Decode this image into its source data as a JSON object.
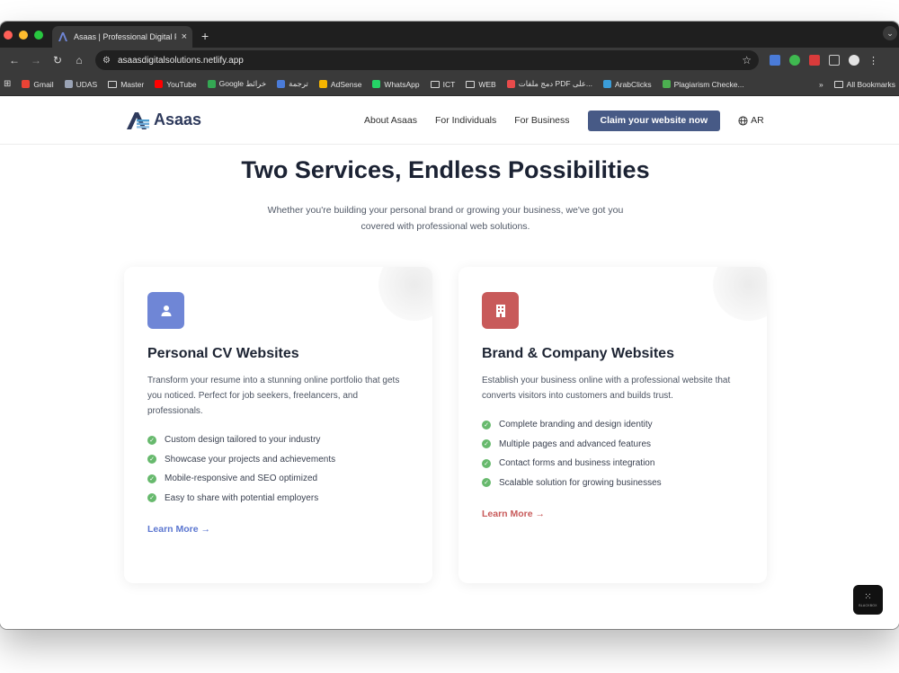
{
  "browser": {
    "tab_title": "Asaas | Professional Digital Pr",
    "url": "asaasdigitalsolutions.netlify.app",
    "new_tab": "+",
    "bookmarks": [
      {
        "label": "Gmail",
        "kind": "gmail",
        "color": "#ea4335"
      },
      {
        "label": "UDAS",
        "kind": "site",
        "color": "#9aa3b5"
      },
      {
        "label": "Master",
        "kind": "folder"
      },
      {
        "label": "YouTube",
        "kind": "site",
        "color": "#ff0000"
      },
      {
        "label": "Google خرائط",
        "kind": "site",
        "color": "#34a853"
      },
      {
        "label": "ترجمة",
        "kind": "site",
        "color": "#4a7bd8"
      },
      {
        "label": "AdSense",
        "kind": "site",
        "color": "#f4b400"
      },
      {
        "label": "WhatsApp",
        "kind": "site",
        "color": "#25d366"
      },
      {
        "label": "ICT",
        "kind": "folder"
      },
      {
        "label": "WEB",
        "kind": "folder"
      },
      {
        "label": "دمج ملفات PDF على...",
        "kind": "site",
        "color": "#e84b4b"
      },
      {
        "label": "ArabClicks",
        "kind": "site",
        "color": "#3b9dd8"
      },
      {
        "label": "Plagiarism Checke...",
        "kind": "site",
        "color": "#4caf50"
      }
    ],
    "overflow": "»",
    "all_bookmarks": "All Bookmarks"
  },
  "site": {
    "logo_text": "Asaas",
    "nav": {
      "about": "About Asaas",
      "individuals": "For Individuals",
      "business": "For Business",
      "cta": "Claim your website now",
      "lang": "AR"
    },
    "hero": {
      "title": "Two Services, Endless Possibilities",
      "subtitle_line1": "Whether you're building your personal brand or growing your business, we've got you",
      "subtitle_line2": "covered with professional web solutions."
    },
    "cards": [
      {
        "title": "Personal CV Websites",
        "icon": "user-icon",
        "accent": "#6f86d6",
        "description": "Transform your resume into a stunning online portfolio that gets you noticed. Perfect for job seekers, freelancers, and professionals.",
        "features": [
          "Custom design tailored to your industry",
          "Showcase your projects and achievements",
          "Mobile-responsive and SEO optimized",
          "Easy to share with potential employers"
        ],
        "link": "Learn More →"
      },
      {
        "title": "Brand & Company Websites",
        "icon": "building-icon",
        "accent": "#c85a5a",
        "description": "Establish your business online with a professional website that converts visitors into customers and builds trust.",
        "features": [
          "Complete branding and design identity",
          "Multiple pages and advanced features",
          "Contact forms and business integration",
          "Scalable solution for growing businesses"
        ],
        "link": "Learn More →"
      }
    ],
    "widget_label": "BLACKBOX"
  }
}
